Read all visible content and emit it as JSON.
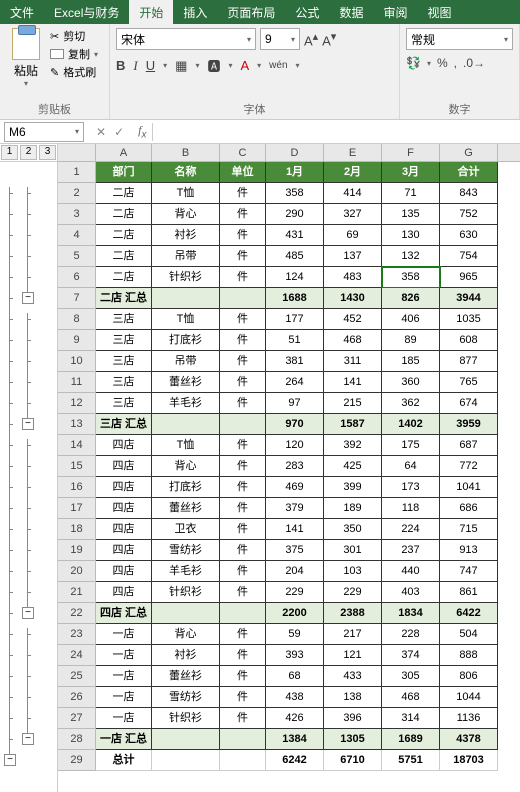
{
  "menu": {
    "tabs": [
      "文件",
      "Excel与财务",
      "开始",
      "插入",
      "页面布局",
      "公式",
      "数据",
      "审阅",
      "视图"
    ],
    "active": 2
  },
  "ribbon": {
    "clip": {
      "paste": "粘贴",
      "cut": "剪切",
      "copy": "复制",
      "fmt": "格式刷",
      "label": "剪贴板"
    },
    "font": {
      "name": "宋体",
      "size": "9",
      "btns": {
        "b": "B",
        "i": "I",
        "u": "U"
      },
      "label": "字体",
      "wen": "wén"
    },
    "num": {
      "sel": "常规",
      "label": "数字"
    }
  },
  "formula": {
    "cellref": "M6"
  },
  "outline": {
    "levels": [
      "1",
      "2",
      "3"
    ]
  },
  "cols": [
    "A",
    "B",
    "C",
    "D",
    "E",
    "F",
    "G"
  ],
  "header": [
    "部门",
    "名称",
    "单位",
    "1月",
    "2月",
    "3月",
    "合计"
  ],
  "rows": [
    {
      "n": 1,
      "type": "header"
    },
    {
      "n": 2,
      "d": [
        "二店",
        "T恤",
        "件",
        "358",
        "414",
        "71",
        "843"
      ]
    },
    {
      "n": 3,
      "d": [
        "二店",
        "背心",
        "件",
        "290",
        "327",
        "135",
        "752"
      ]
    },
    {
      "n": 4,
      "d": [
        "二店",
        "衬衫",
        "件",
        "431",
        "69",
        "130",
        "630"
      ]
    },
    {
      "n": 5,
      "d": [
        "二店",
        "吊带",
        "件",
        "485",
        "137",
        "132",
        "754"
      ]
    },
    {
      "n": 6,
      "d": [
        "二店",
        "针织衫",
        "件",
        "124",
        "483",
        "358",
        "965"
      ],
      "active": 5
    },
    {
      "n": 7,
      "type": "sub",
      "d": [
        "二店 汇总",
        "",
        "",
        "1688",
        "1430",
        "826",
        "3944"
      ]
    },
    {
      "n": 8,
      "d": [
        "三店",
        "T恤",
        "件",
        "177",
        "452",
        "406",
        "1035"
      ]
    },
    {
      "n": 9,
      "d": [
        "三店",
        "打底衫",
        "件",
        "51",
        "468",
        "89",
        "608"
      ]
    },
    {
      "n": 10,
      "d": [
        "三店",
        "吊带",
        "件",
        "381",
        "311",
        "185",
        "877"
      ]
    },
    {
      "n": 11,
      "d": [
        "三店",
        "蕾丝衫",
        "件",
        "264",
        "141",
        "360",
        "765"
      ]
    },
    {
      "n": 12,
      "d": [
        "三店",
        "羊毛衫",
        "件",
        "97",
        "215",
        "362",
        "674"
      ]
    },
    {
      "n": 13,
      "type": "sub",
      "d": [
        "三店 汇总",
        "",
        "",
        "970",
        "1587",
        "1402",
        "3959"
      ]
    },
    {
      "n": 14,
      "d": [
        "四店",
        "T恤",
        "件",
        "120",
        "392",
        "175",
        "687"
      ]
    },
    {
      "n": 15,
      "d": [
        "四店",
        "背心",
        "件",
        "283",
        "425",
        "64",
        "772"
      ]
    },
    {
      "n": 16,
      "d": [
        "四店",
        "打底衫",
        "件",
        "469",
        "399",
        "173",
        "1041"
      ]
    },
    {
      "n": 17,
      "d": [
        "四店",
        "蕾丝衫",
        "件",
        "379",
        "189",
        "118",
        "686"
      ]
    },
    {
      "n": 18,
      "d": [
        "四店",
        "卫衣",
        "件",
        "141",
        "350",
        "224",
        "715"
      ]
    },
    {
      "n": 19,
      "d": [
        "四店",
        "雪纺衫",
        "件",
        "375",
        "301",
        "237",
        "913"
      ]
    },
    {
      "n": 20,
      "d": [
        "四店",
        "羊毛衫",
        "件",
        "204",
        "103",
        "440",
        "747"
      ]
    },
    {
      "n": 21,
      "d": [
        "四店",
        "针织衫",
        "件",
        "229",
        "229",
        "403",
        "861"
      ]
    },
    {
      "n": 22,
      "type": "sub",
      "d": [
        "四店 汇总",
        "",
        "",
        "2200",
        "2388",
        "1834",
        "6422"
      ]
    },
    {
      "n": 23,
      "d": [
        "一店",
        "背心",
        "件",
        "59",
        "217",
        "228",
        "504"
      ]
    },
    {
      "n": 24,
      "d": [
        "一店",
        "衬衫",
        "件",
        "393",
        "121",
        "374",
        "888"
      ]
    },
    {
      "n": 25,
      "d": [
        "一店",
        "蕾丝衫",
        "件",
        "68",
        "433",
        "305",
        "806"
      ]
    },
    {
      "n": 26,
      "d": [
        "一店",
        "雪纺衫",
        "件",
        "438",
        "138",
        "468",
        "1044"
      ]
    },
    {
      "n": 27,
      "d": [
        "一店",
        "针织衫",
        "件",
        "426",
        "396",
        "314",
        "1136"
      ]
    },
    {
      "n": 28,
      "type": "sub",
      "d": [
        "一店 汇总",
        "",
        "",
        "1384",
        "1305",
        "1689",
        "4378"
      ]
    },
    {
      "n": 29,
      "type": "total",
      "d": [
        "总计",
        "",
        "",
        "6242",
        "6710",
        "5751",
        "18703"
      ]
    }
  ]
}
